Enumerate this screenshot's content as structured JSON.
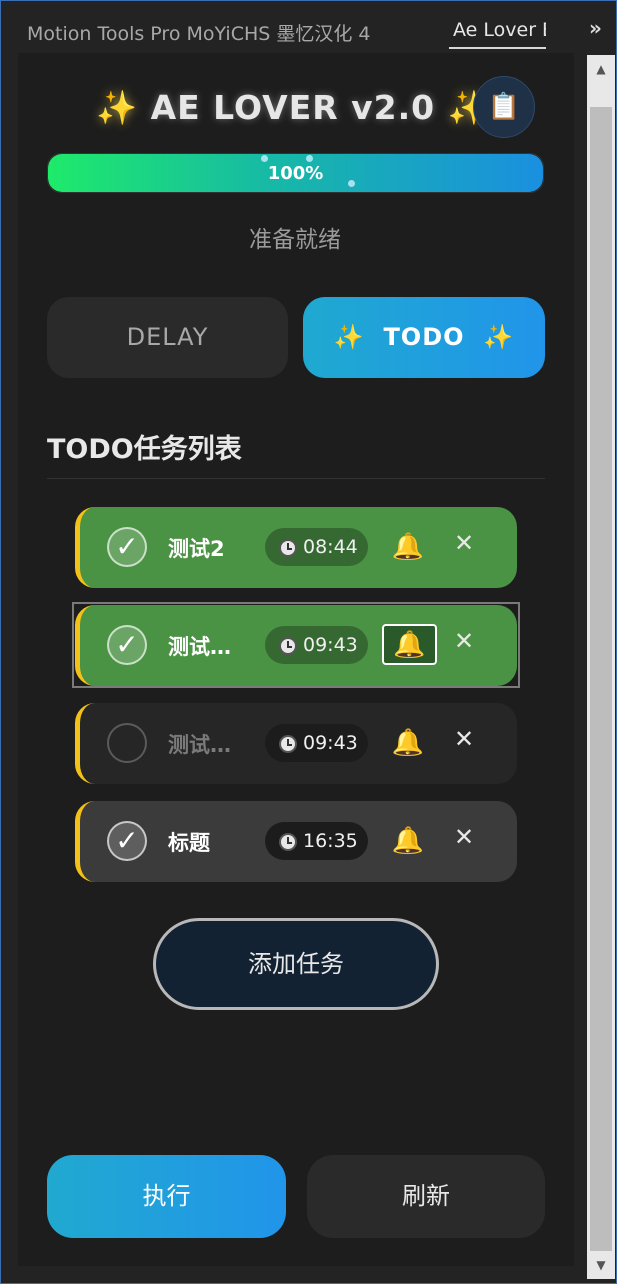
{
  "tabs": [
    {
      "label": "Motion Tools Pro MoYiCHS 墨忆汉化 4"
    },
    {
      "label": "Ae Lover Ex"
    }
  ],
  "header": {
    "title_text": "AE LOVER v2.0",
    "spark_left": "✨",
    "spark_right": "✨",
    "clipboard_icon": "📋"
  },
  "progress": {
    "percent": 100,
    "label": "100%"
  },
  "status_text": "准备就绪",
  "modes": {
    "delay_label": "DELAY",
    "todo_label": "TODO",
    "spark": "✨",
    "active": "TODO"
  },
  "section_title": "TODO任务列表",
  "todos": [
    {
      "name": "测试2",
      "time": "08:44",
      "done": true
    },
    {
      "name": "测试…",
      "time": "09:43",
      "done": true
    },
    {
      "name": "测试…",
      "time": "09:43",
      "done": false
    },
    {
      "name": "标题",
      "time": "16:35",
      "done": true
    }
  ],
  "icons": {
    "check": "✓",
    "bell": "🔔",
    "delete": "✕"
  },
  "buttons": {
    "add_task": "添加任务",
    "run": "执行",
    "refresh": "刷新"
  },
  "colors": {
    "accent_blue": "#2195ea",
    "done_green": "#4a9244",
    "marker_yellow": "#f2c21a"
  }
}
